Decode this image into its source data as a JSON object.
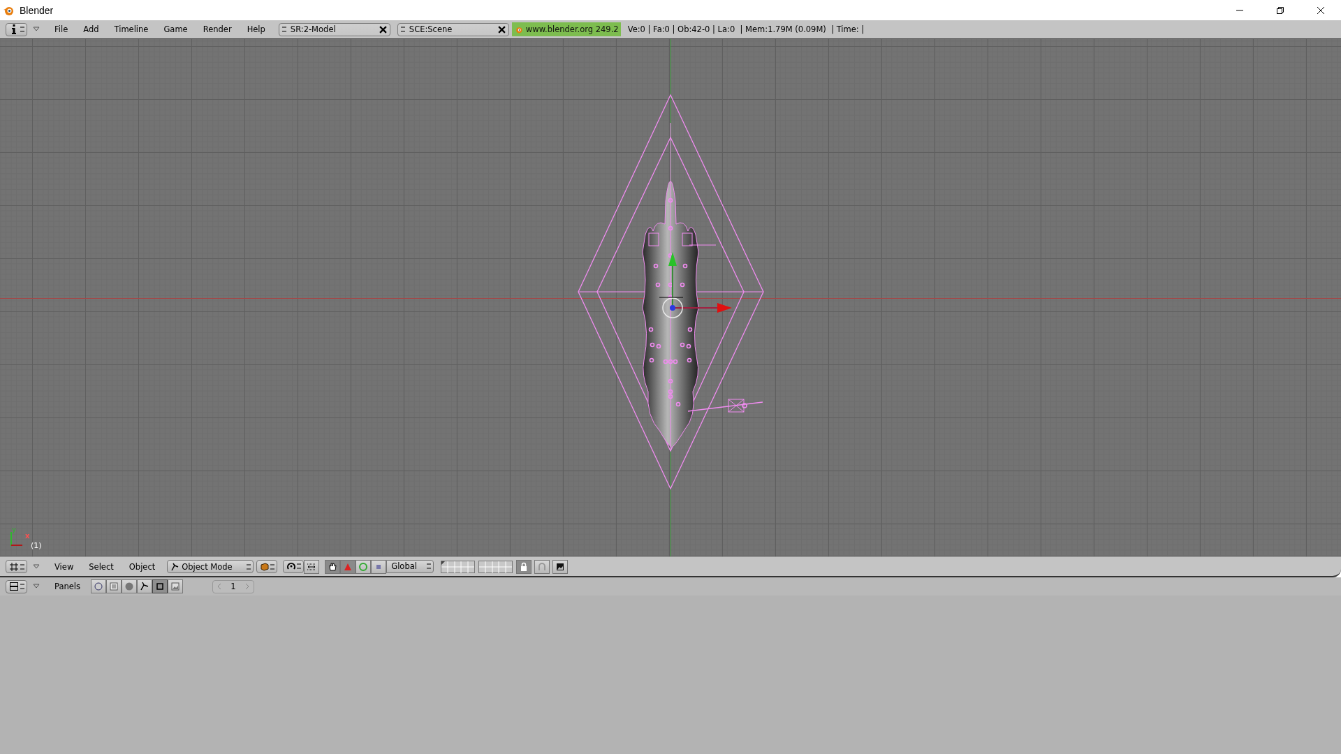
{
  "window": {
    "title": "Blender"
  },
  "info_header": {
    "menus": [
      "File",
      "Add",
      "Timeline",
      "Game",
      "Render",
      "Help"
    ],
    "screen": "SR:2-Model",
    "scene": "SCE:Scene",
    "version": "www.blender.org 249.2",
    "stats": "Ve:0 | Fa:0 | Ob:42-0 | La:0  | Mem:1.79M (0.09M)  | Time: |"
  },
  "viewport": {
    "axis_x": "x",
    "axis_y": "y",
    "frame": "(1)"
  },
  "view_header": {
    "menus": [
      "View",
      "Select",
      "Object"
    ],
    "mode": "Object Mode",
    "orientation": "Global"
  },
  "buttons_header": {
    "menu": "Panels",
    "tabs": [
      {
        "selected": false
      },
      {
        "selected": false
      },
      {
        "selected": false
      },
      {
        "selected": false
      },
      {
        "selected": true
      },
      {
        "selected": false
      }
    ],
    "frame": "1"
  }
}
